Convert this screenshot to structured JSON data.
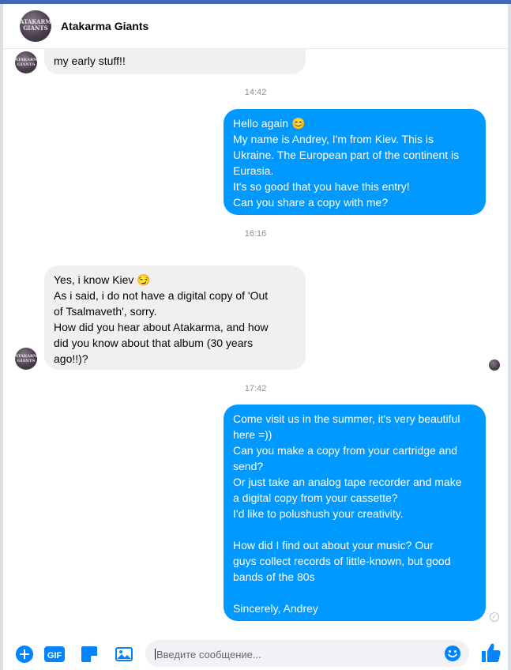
{
  "header": {
    "title": "Atakarma Giants",
    "avatar_text": "ATAKARMA\nGIANTS"
  },
  "messages": [
    {
      "dir": "in",
      "lines": [
        "my early stuff!!"
      ],
      "partial_line": ""
    },
    {
      "dir": "out",
      "lines": [
        "Hello again 😊",
        "My name is Andrey, I'm from Kiev. This is",
        "Ukraine. The European part of the continent is",
        "Eurasia.",
        "It's so good that you have this entry!",
        "Can you share a copy with me?"
      ]
    },
    {
      "dir": "in",
      "lines": [
        "Yes, i know Kiev 😏",
        "As i said, i do not have a digital copy of 'Out",
        "of Tsalmaveth', sorry.",
        "How did you hear about Atakarma, and how",
        "did you know about that album (30 years",
        "ago!!)?"
      ]
    },
    {
      "dir": "out",
      "lines": [
        "Come visit us in the summer, it's very beautiful",
        "here =))",
        "Can you make a copy from your cartridge and",
        "send?",
        "Or just take an analog tape recorder and make",
        "a digital copy from your cassette?",
        "I'd like to polushush your creativity.",
        "",
        "How did I find out about your music? Our",
        "guys collect records of little-known, but good",
        "bands of the 80s",
        "",
        "Sincerely, Andrey"
      ]
    }
  ],
  "timestamps": [
    "14:42",
    "16:16",
    "17:42"
  ],
  "composer": {
    "placeholder": "Введите сообщение...",
    "gif_label": "GIF"
  },
  "colors": {
    "accent": "#0099ff",
    "incoming_bubble": "#f0f0f0",
    "topbar": "#4267b2"
  },
  "icons": [
    "add-icon",
    "gif-icon",
    "sticker-icon",
    "photo-icon",
    "emoji-icon",
    "like-icon"
  ]
}
